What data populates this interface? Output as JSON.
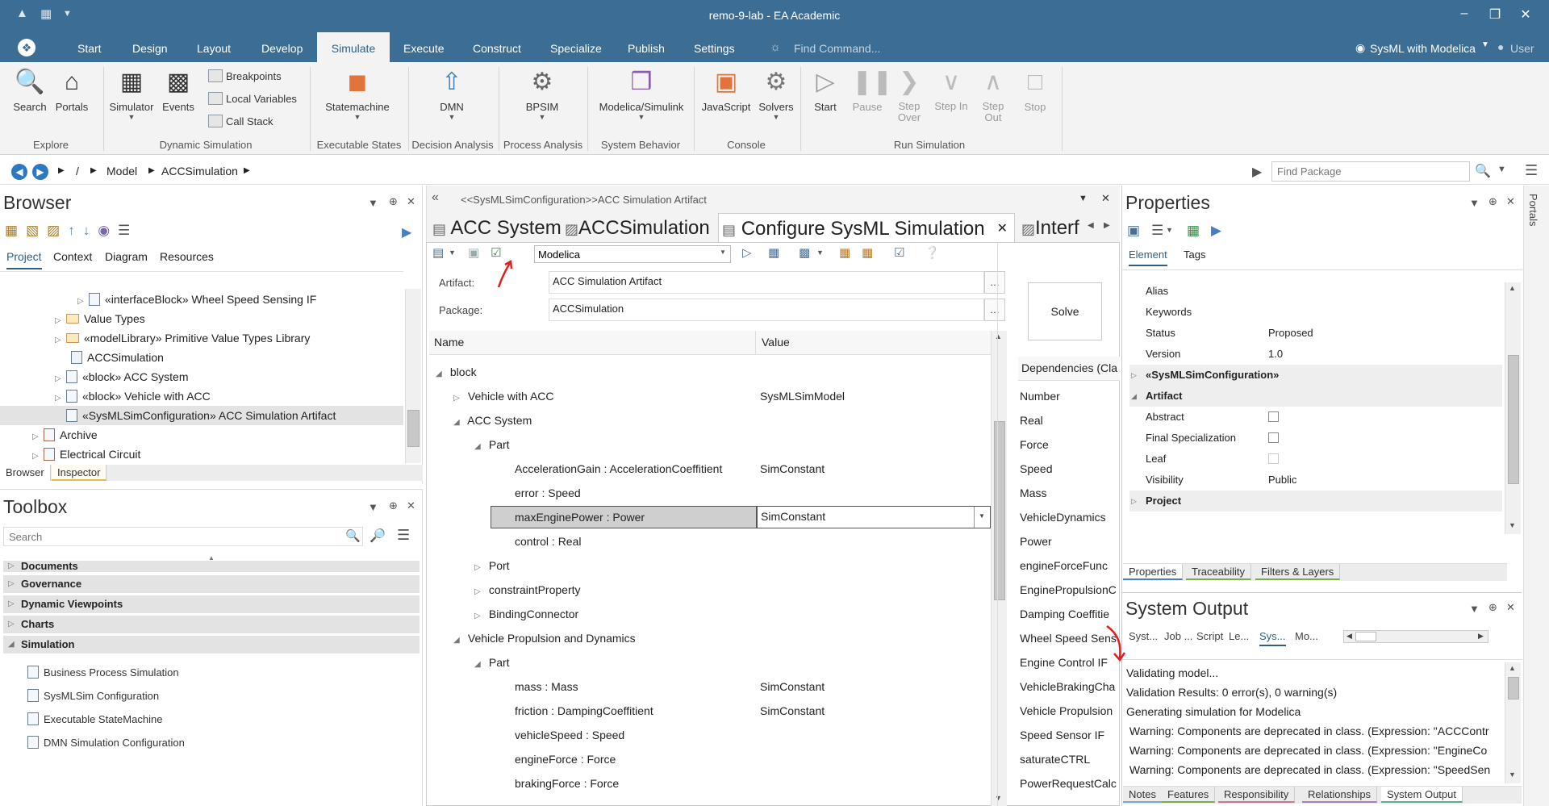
{
  "window": {
    "title": "remo-9-lab - EA Academic"
  },
  "menu": {
    "tabs": [
      "Start",
      "Design",
      "Layout",
      "Develop",
      "Simulate",
      "Execute",
      "Construct",
      "Specialize",
      "Publish",
      "Settings"
    ],
    "active": "Simulate",
    "find_placeholder": "Find Command...",
    "perspective": "SysML with Modelica",
    "user": "User"
  },
  "ribbon": {
    "explore": {
      "search": "Search",
      "portals": "Portals",
      "label": "Explore"
    },
    "dynamic": {
      "simulator": "Simulator",
      "events": "Events",
      "breakpoints": "Breakpoints",
      "local_variables": "Local Variables",
      "call_stack": "Call Stack",
      "label": "Dynamic Simulation"
    },
    "executable": {
      "statemachine": "Statemachine",
      "label": "Executable States"
    },
    "decision": {
      "dmn": "DMN",
      "label": "Decision Analysis"
    },
    "process": {
      "bpsim": "BPSIM",
      "label": "Process Analysis"
    },
    "system": {
      "modelica": "Modelica/Simulink",
      "label": "System Behavior"
    },
    "console": {
      "javascript": "JavaScript",
      "solvers": "Solvers",
      "label": "Console"
    },
    "run": {
      "start": "Start",
      "pause": "Pause",
      "step_over": "Step Over",
      "step_in": "Step In",
      "step_out": "Step Out",
      "stop": "Stop",
      "label": "Run Simulation"
    }
  },
  "breadcrumb": {
    "root": "/",
    "model": "Model",
    "pkg": "ACCSimulation",
    "find_placeholder": "Find Package"
  },
  "browser": {
    "title": "Browser",
    "tabs": [
      "Project",
      "Context",
      "Diagram",
      "Resources"
    ],
    "items": [
      {
        "label": "«interfaceBlock» Wheel Speed Sensing IF"
      },
      {
        "label": "Value Types"
      },
      {
        "label": "«modelLibrary» Primitive Value Types Library"
      },
      {
        "label": "ACCSimulation"
      },
      {
        "label": "«block» ACC System"
      },
      {
        "label": "«block» Vehicle with ACC"
      },
      {
        "label": "«SysMLSimConfiguration» ACC Simulation Artifact"
      },
      {
        "label": "Archive"
      },
      {
        "label": "Electrical Circuit"
      }
    ],
    "bottom_tabs": [
      "Browser",
      "Inspector"
    ]
  },
  "toolbox": {
    "title": "Toolbox",
    "search_placeholder": "Search",
    "categories": [
      "Documents",
      "Governance",
      "Dynamic Viewpoints",
      "Charts",
      "Simulation"
    ],
    "items": [
      "Business Process Simulation",
      "SysMLSim Configuration",
      "Executable StateMachine",
      "DMN Simulation Configuration"
    ]
  },
  "center": {
    "path": "<<SysMLSimConfiguration>>ACC Simulation Artifact",
    "tabs": [
      "ACC System",
      "ACCSimulation",
      "Configure SysML Simulation",
      "Interf"
    ],
    "platform": "Modelica",
    "artifact_label": "Artifact:",
    "artifact_value": "ACC Simulation Artifact",
    "package_label": "Package:",
    "package_value": "ACCSimulation",
    "solve": "Solve",
    "col_name": "Name",
    "col_value": "Value",
    "deps_header": "Dependencies (Cla",
    "rows": [
      {
        "name": "block",
        "value": ""
      },
      {
        "name": "Vehicle with ACC",
        "value": "SysMLSimModel"
      },
      {
        "name": "ACC System",
        "value": ""
      },
      {
        "name": "Part",
        "value": ""
      },
      {
        "name": "AccelerationGain : AccelerationCoeffitient",
        "value": "SimConstant"
      },
      {
        "name": "error : Speed",
        "value": ""
      },
      {
        "name": "maxEnginePower : Power",
        "value": "SimConstant"
      },
      {
        "name": "control : Real",
        "value": ""
      },
      {
        "name": "Port",
        "value": ""
      },
      {
        "name": "constraintProperty",
        "value": ""
      },
      {
        "name": "BindingConnector",
        "value": ""
      },
      {
        "name": "Vehicle Propulsion and Dynamics",
        "value": ""
      },
      {
        "name": "Part",
        "value": ""
      },
      {
        "name": "mass : Mass",
        "value": "SimConstant"
      },
      {
        "name": "friction : DampingCoeffitient",
        "value": "SimConstant"
      },
      {
        "name": "vehicleSpeed : Speed",
        "value": ""
      },
      {
        "name": "engineForce : Force",
        "value": ""
      },
      {
        "name": "brakingForce : Force",
        "value": ""
      }
    ],
    "deps": [
      "Number",
      "Real",
      "Force",
      "Speed",
      "Mass",
      "VehicleDynamics",
      "Power",
      "engineForceFunc",
      "EnginePropulsionC",
      "Damping Coeffitie",
      "Wheel Speed Sens",
      "Engine Control IF",
      "VehicleBrakingCha",
      "Vehicle Propulsion",
      "Speed Sensor IF",
      "saturateCTRL",
      "PowerRequestCalc"
    ]
  },
  "properties": {
    "title": "Properties",
    "tabs": [
      "Element",
      "Tags"
    ],
    "rows": [
      {
        "name": "Alias",
        "value": ""
      },
      {
        "name": "Keywords",
        "value": ""
      },
      {
        "name": "Status",
        "value": "Proposed"
      },
      {
        "name": "Version",
        "value": "1.0"
      },
      {
        "name": "«SysMLSimConfiguration»",
        "value": ""
      },
      {
        "name": "Artifact",
        "value": ""
      },
      {
        "name": "Abstract",
        "value": ""
      },
      {
        "name": "Final Specialization",
        "value": ""
      },
      {
        "name": "Leaf",
        "value": ""
      },
      {
        "name": "Visibility",
        "value": "Public"
      },
      {
        "name": "Project",
        "value": ""
      }
    ],
    "bottom_tabs": [
      "Properties",
      "Traceability",
      "Filters & Layers"
    ]
  },
  "output": {
    "title": "System Output",
    "tabs": [
      "Syst...",
      "Job ...",
      "Script",
      "Le...",
      "Sys...",
      "Mo..."
    ],
    "lines": [
      "Validating model...",
      "Validation Results: 0 error(s), 0 warning(s)",
      "Generating simulation for Modelica",
      " Warning: Components are deprecated in class. (Expression: \"ACCContr",
      " Warning: Components are deprecated in class. (Expression: \"EngineCo",
      " Warning: Components are deprecated in class. (Expression: \"SpeedSen"
    ],
    "bottom_tabs": [
      "Notes",
      "Features",
      "Responsibility",
      "Relationships",
      "System Output"
    ]
  },
  "side": {
    "portals": "Portals"
  },
  "colors": {
    "accent": "#3b6d95",
    "arrow": "#e0201c",
    "selection": "#cfcfcf"
  }
}
